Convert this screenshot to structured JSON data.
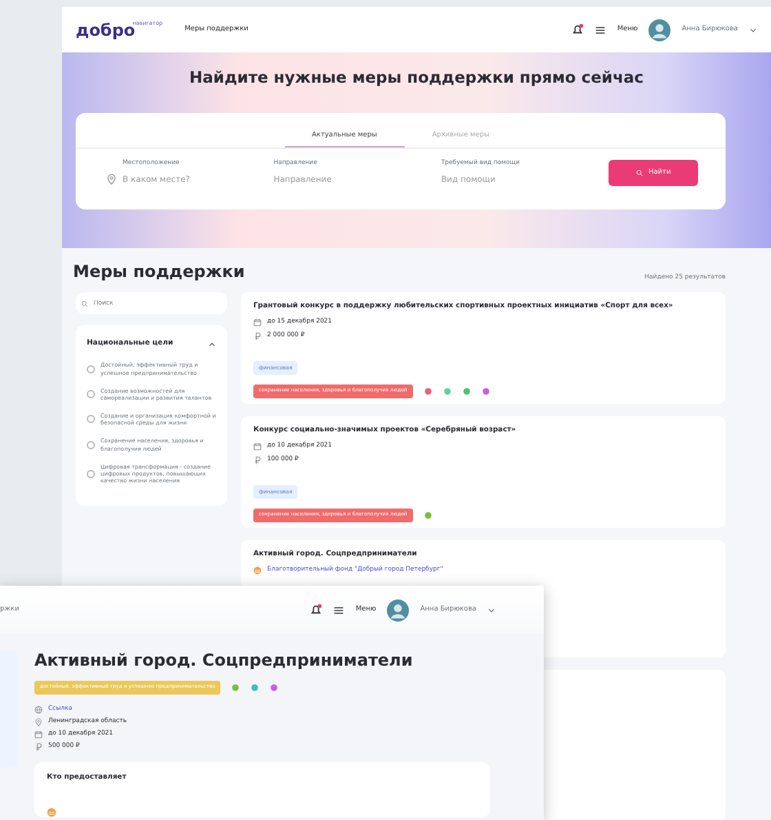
{
  "header": {
    "logo": "добро",
    "logo_caption": "навигатор",
    "nav_link": "Меры поддержки",
    "menu": "Меню",
    "user": "Анна Бирюкова"
  },
  "hero": {
    "title": "Найдите нужные меры поддержки прямо сейчас",
    "tabs": [
      {
        "label": "Актуальные меры",
        "selected": true
      },
      {
        "label": "Архивные меры",
        "selected": false
      }
    ],
    "fields": [
      {
        "kind": "location",
        "label": "Местоположение",
        "placeholder": "В каком месте?"
      },
      {
        "kind": "plain",
        "label": "Направление",
        "placeholder": "Направление"
      },
      {
        "kind": "plain",
        "label": "Требуемый вид помощи",
        "placeholder": "Вид помощи"
      }
    ],
    "search_button": "Найти"
  },
  "section": {
    "title": "Меры поддержки",
    "results": "Найдено 25 результатов"
  },
  "sidebar": {
    "search_placeholder": "Поиск",
    "filter": {
      "title": "Национальные цели",
      "expanded": true,
      "options": [
        {
          "label": "Достойный, эффективный труд и успешное предпринимательство",
          "checked": false
        },
        {
          "label": "Создание возможностей для самореализации и развития талантов",
          "checked": false
        },
        {
          "label": "Создание и организация комфортной и безопасной среды для жизни",
          "checked": false
        },
        {
          "label": "Сохранение населения, здоровья и благополучия людей",
          "checked": false
        },
        {
          "label": "Цифровая трансформация - создание цифровых продуктов, повышающих качество жизни населения",
          "checked": false
        }
      ]
    }
  },
  "cards": [
    {
      "kind": "measure",
      "title": "Грантовый конкурс в поддержку любительских спортивных проектных инициатив «Спорт для всех»",
      "date": "до 15 декабря 2021",
      "amount": "2 000 000 ₽",
      "type_tag": "финансовая",
      "goal_tag": {
        "text": "сохранение населения, здоровья и благополучия людей",
        "color": "#f06b6b"
      },
      "goal_icons": [
        {
          "color": "#e8607e"
        },
        {
          "color": "#5fd39a"
        },
        {
          "color": "#4cc46a"
        },
        {
          "color": "#c860e0"
        }
      ]
    },
    {
      "kind": "measure",
      "title": "Конкурс социально-значимых проектов «Серебряный возраст»",
      "date": "до 10 декабря 2021",
      "amount": "100 000 ₽",
      "type_tag": "финансовая",
      "goal_tag": {
        "text": "сохранение населения, здоровья и благополучия людей",
        "color": "#f06b6b"
      },
      "goal_icons": [
        {
          "color": "#7cbf3a"
        }
      ]
    },
    {
      "kind": "org",
      "title": "Активный город. Соцпредприниматели",
      "org": "Благотворительный фонд \"Добрый город Петербург\""
    },
    {
      "kind": "empty"
    }
  ],
  "detail_window": {
    "nav_fragment": "ржки",
    "menu": "Меню",
    "user": "Анна Бирюкова",
    "title": "Активный город. Соцпредприниматели",
    "goal_tag": {
      "text": "достойный, эффективный труд и успешное предпринимательство",
      "color": "#ecc85a"
    },
    "goal_icons": [
      {
        "color": "#7cbf3a"
      },
      {
        "color": "#3cc0b0"
      },
      {
        "color": "#c860e0"
      }
    ],
    "details": [
      {
        "kind": "link",
        "text": "Ссылка"
      },
      {
        "kind": "location",
        "text": "Ленинградская область"
      },
      {
        "kind": "date",
        "text": "до 10 декабря 2021"
      },
      {
        "kind": "amount",
        "text": "500 000 ₽"
      }
    ],
    "provider_title": "Кто предоставляет"
  }
}
